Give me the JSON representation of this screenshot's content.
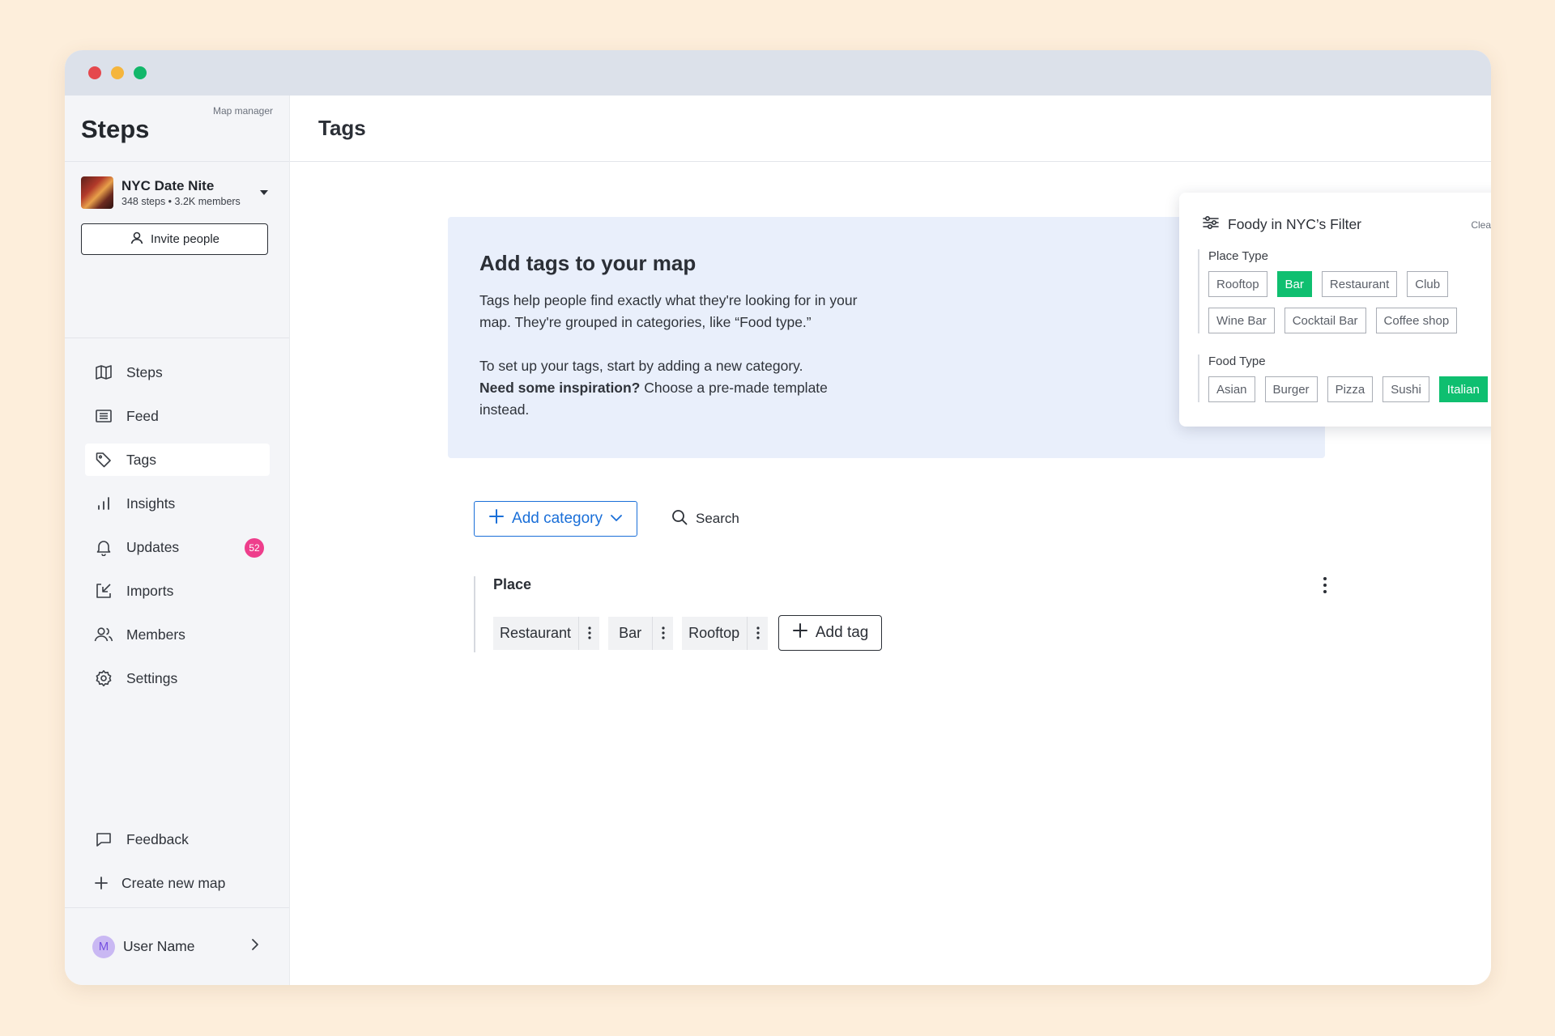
{
  "window": {
    "controls": [
      {
        "name": "close",
        "color": "#e5484d"
      },
      {
        "name": "minimize",
        "color": "#f5b53c"
      },
      {
        "name": "maximize",
        "color": "#12b76a"
      }
    ]
  },
  "sidebar": {
    "brand": "Steps",
    "role": "Map manager",
    "map": {
      "name": "NYC Date Nite",
      "meta": "348 steps • 3.2K members"
    },
    "invite_label": "Invite people",
    "items": [
      {
        "label": "Steps",
        "icon": "map-icon"
      },
      {
        "label": "Feed",
        "icon": "feed-icon"
      },
      {
        "label": "Tags",
        "icon": "tag-icon",
        "active": true
      },
      {
        "label": "Insights",
        "icon": "bar-chart-icon"
      },
      {
        "label": "Updates",
        "icon": "bell-icon",
        "badge": "52"
      },
      {
        "label": "Imports",
        "icon": "import-icon"
      },
      {
        "label": "Members",
        "icon": "members-icon"
      },
      {
        "label": "Settings",
        "icon": "gear-icon"
      }
    ],
    "bottom_items": [
      {
        "label": "Feedback",
        "icon": "chat-icon"
      },
      {
        "label": "Create new map",
        "icon": "plus-icon"
      }
    ],
    "user": {
      "initial": "M",
      "name": "User Name"
    }
  },
  "main": {
    "title": "Tags",
    "info": {
      "title": "Add tags to your map",
      "body1": "Tags help people find exactly what they're looking for in your map. They're grouped in categories, like “Food type.”",
      "body2_prefix": "To set up your tags, start by adding a new category.",
      "body2_bold": "Need some inspiration?",
      "body2_suffix": " Choose a pre-made template instead."
    },
    "filter_card": {
      "title": "Foody in NYC’s Filter",
      "clear": "Clear",
      "groups": [
        {
          "label": "Place Type",
          "rows": [
            [
              {
                "label": "Rooftop"
              },
              {
                "label": "Bar",
                "on": true
              },
              {
                "label": "Restaurant"
              },
              {
                "label": "Club"
              }
            ],
            [
              {
                "label": "Wine Bar"
              },
              {
                "label": "Cocktail Bar"
              },
              {
                "label": "Coffee shop"
              }
            ]
          ]
        },
        {
          "label": "Food Type",
          "rows": [
            [
              {
                "label": "Asian"
              },
              {
                "label": "Burger"
              },
              {
                "label": "Pizza"
              },
              {
                "label": "Sushi"
              },
              {
                "label": "Italian",
                "on": true
              }
            ]
          ]
        }
      ]
    },
    "actions": {
      "add_category": "Add category",
      "search": "Search"
    },
    "category": {
      "name": "Place",
      "tags": [
        "Restaurant",
        "Bar",
        "Rooftop"
      ],
      "add_tag": "Add tag"
    }
  },
  "colors": {
    "accent_blue": "#1a6fd8",
    "chip_selected_green": "#0fbf70",
    "badge_pink": "#ee3e8c",
    "page_background": "#fdeedb"
  }
}
